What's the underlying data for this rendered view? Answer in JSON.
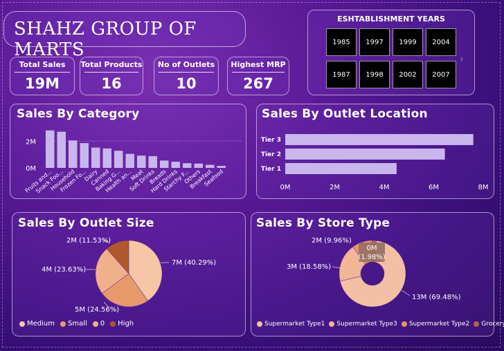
{
  "header": {
    "title": "SHAHZ GROUP OF MARTS"
  },
  "kpis": [
    {
      "label": "Total Sales",
      "value": "19M"
    },
    {
      "label": "Total Products",
      "value": "16"
    },
    {
      "label": "No of Outlets",
      "value": "10"
    },
    {
      "label": "Highest MRP",
      "value": "267"
    }
  ],
  "establishment": {
    "title": "ESHTABLISHMENT YEARS",
    "years": [
      "1985",
      "1997",
      "1999",
      "2004",
      "1987",
      "1998",
      "2002",
      "2007"
    ]
  },
  "colors": {
    "bar": "#c8b6ec",
    "pie_medium": "#f6c6a6",
    "pie_small": "#e99a6a",
    "pie_zero": "#f0b08c",
    "pie_high": "#b0582c"
  },
  "chart_data": [
    {
      "type": "bar",
      "title": "Sales By Category",
      "categories": [
        "Fruits and...",
        "Snack Foo...",
        "Household",
        "Frozen Fo...",
        "Dairy",
        "Canned",
        "Baking G...",
        "Health an...",
        "Meat",
        "Soft Drinks",
        "Breads",
        "Hard Drinks",
        "Starchy F...",
        "Others",
        "Breakfast",
        "Seafood"
      ],
      "values": [
        2.8,
        2.7,
        2.05,
        1.85,
        1.52,
        1.45,
        1.28,
        1.05,
        0.92,
        0.88,
        0.55,
        0.46,
        0.35,
        0.32,
        0.23,
        0.15
      ],
      "yticks": [
        "0M",
        "2M"
      ],
      "ylim": [
        0,
        3.2
      ],
      "grid": true
    },
    {
      "type": "bar",
      "orientation": "horizontal",
      "title": "Sales By Outlet Location",
      "categories": [
        "Tier 3",
        "Tier 2",
        "Tier 1"
      ],
      "values": [
        7.6,
        6.45,
        4.5
      ],
      "xticks": [
        "0M",
        "2M",
        "4M",
        "6M",
        "8M"
      ],
      "xlim": [
        0,
        8
      ]
    },
    {
      "type": "pie",
      "title": "Sales By Outlet Size",
      "slices": [
        {
          "name": "Medium",
          "label": "7M (40.29%)",
          "value": 40.29
        },
        {
          "name": "Small",
          "label": "5M (24.56%)",
          "value": 24.56
        },
        {
          "name": "0",
          "label": "4M (23.63%)",
          "value": 23.63
        },
        {
          "name": "High",
          "label": "2M (11.53%)",
          "value": 11.53
        }
      ],
      "legend": "bottom-left"
    },
    {
      "type": "pie",
      "donut": true,
      "title": "Sales By Store Type",
      "slices": [
        {
          "name": "Supermarket Type1",
          "label": "13M (69.48%)",
          "value": 69.48
        },
        {
          "name": "Supermarket Type3",
          "label": "3M (18.58%)",
          "value": 18.58
        },
        {
          "name": "Supermarket Type2",
          "label": "2M (9.96%)",
          "value": 9.96
        },
        {
          "name": "Grocery Store",
          "label": "0M\n(1.98%)",
          "value": 1.98
        }
      ],
      "legend": "bottom-left"
    }
  ]
}
